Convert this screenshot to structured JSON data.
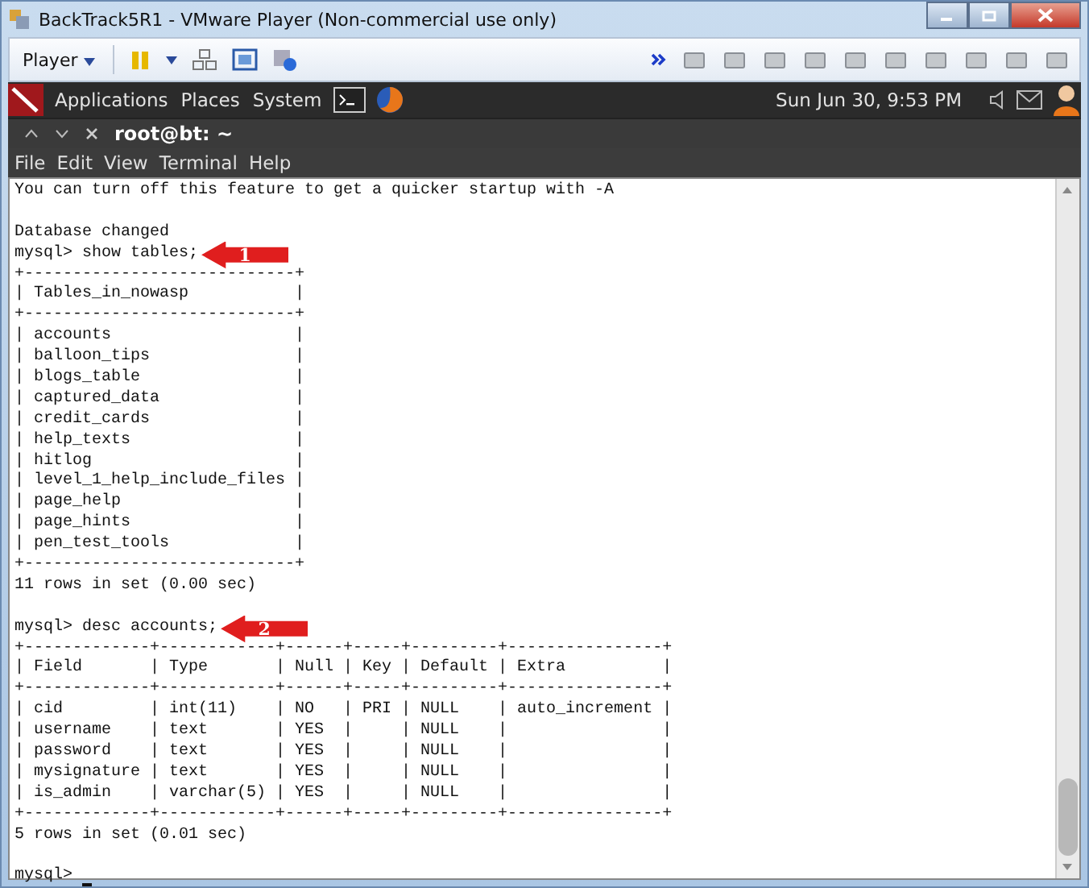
{
  "window": {
    "title": "BackTrack5R1 - VMware Player (Non-commercial use only)"
  },
  "toolbar": {
    "menu": "Player"
  },
  "panel": {
    "menus": [
      "Applications",
      "Places",
      "System"
    ],
    "clock": "Sun Jun 30,  9:53 PM"
  },
  "terminal": {
    "tab_title": "root@bt: ~",
    "menu": [
      "File",
      "Edit",
      "View",
      "Terminal",
      "Help"
    ],
    "lines": [
      {
        "kind": "text",
        "text": "You can turn off this feature to get a quicker startup with -A"
      },
      {
        "kind": "blank"
      },
      {
        "kind": "text",
        "text": "Database changed"
      },
      {
        "kind": "text",
        "text": "mysql> show tables;",
        "callout": "1"
      },
      {
        "kind": "text",
        "text": "+----------------------------+"
      },
      {
        "kind": "text",
        "text": "| Tables_in_nowasp           |"
      },
      {
        "kind": "text",
        "text": "+----------------------------+"
      },
      {
        "kind": "text",
        "text": "| accounts                   |"
      },
      {
        "kind": "text",
        "text": "| balloon_tips               |"
      },
      {
        "kind": "text",
        "text": "| blogs_table                |"
      },
      {
        "kind": "text",
        "text": "| captured_data              |"
      },
      {
        "kind": "text",
        "text": "| credit_cards               |"
      },
      {
        "kind": "text",
        "text": "| help_texts                 |"
      },
      {
        "kind": "text",
        "text": "| hitlog                     |"
      },
      {
        "kind": "text",
        "text": "| level_1_help_include_files |"
      },
      {
        "kind": "text",
        "text": "| page_help                  |"
      },
      {
        "kind": "text",
        "text": "| page_hints                 |"
      },
      {
        "kind": "text",
        "text": "| pen_test_tools             |"
      },
      {
        "kind": "text",
        "text": "+----------------------------+"
      },
      {
        "kind": "text",
        "text": "11 rows in set (0.00 sec)"
      },
      {
        "kind": "blank"
      },
      {
        "kind": "text",
        "text": "mysql> desc accounts;",
        "callout": "2"
      },
      {
        "kind": "text",
        "text": "+-------------+------------+------+-----+---------+----------------+"
      },
      {
        "kind": "text",
        "text": "| Field       | Type       | Null | Key | Default | Extra          |"
      },
      {
        "kind": "text",
        "text": "+-------------+------------+------+-----+---------+----------------+"
      },
      {
        "kind": "text",
        "text": "| cid         | int(11)    | NO   | PRI | NULL    | auto_increment |"
      },
      {
        "kind": "text",
        "text": "| username    | text       | YES  |     | NULL    |                |"
      },
      {
        "kind": "text",
        "text": "| password    | text       | YES  |     | NULL    |                |"
      },
      {
        "kind": "text",
        "text": "| mysignature | text       | YES  |     | NULL    |                |"
      },
      {
        "kind": "text",
        "text": "| is_admin    | varchar(5) | YES  |     | NULL    |                |"
      },
      {
        "kind": "text",
        "text": "+-------------+------------+------+-----+---------+----------------+"
      },
      {
        "kind": "text",
        "text": "5 rows in set (0.01 sec)"
      },
      {
        "kind": "blank"
      },
      {
        "kind": "prompt",
        "text": "mysql>"
      }
    ]
  }
}
